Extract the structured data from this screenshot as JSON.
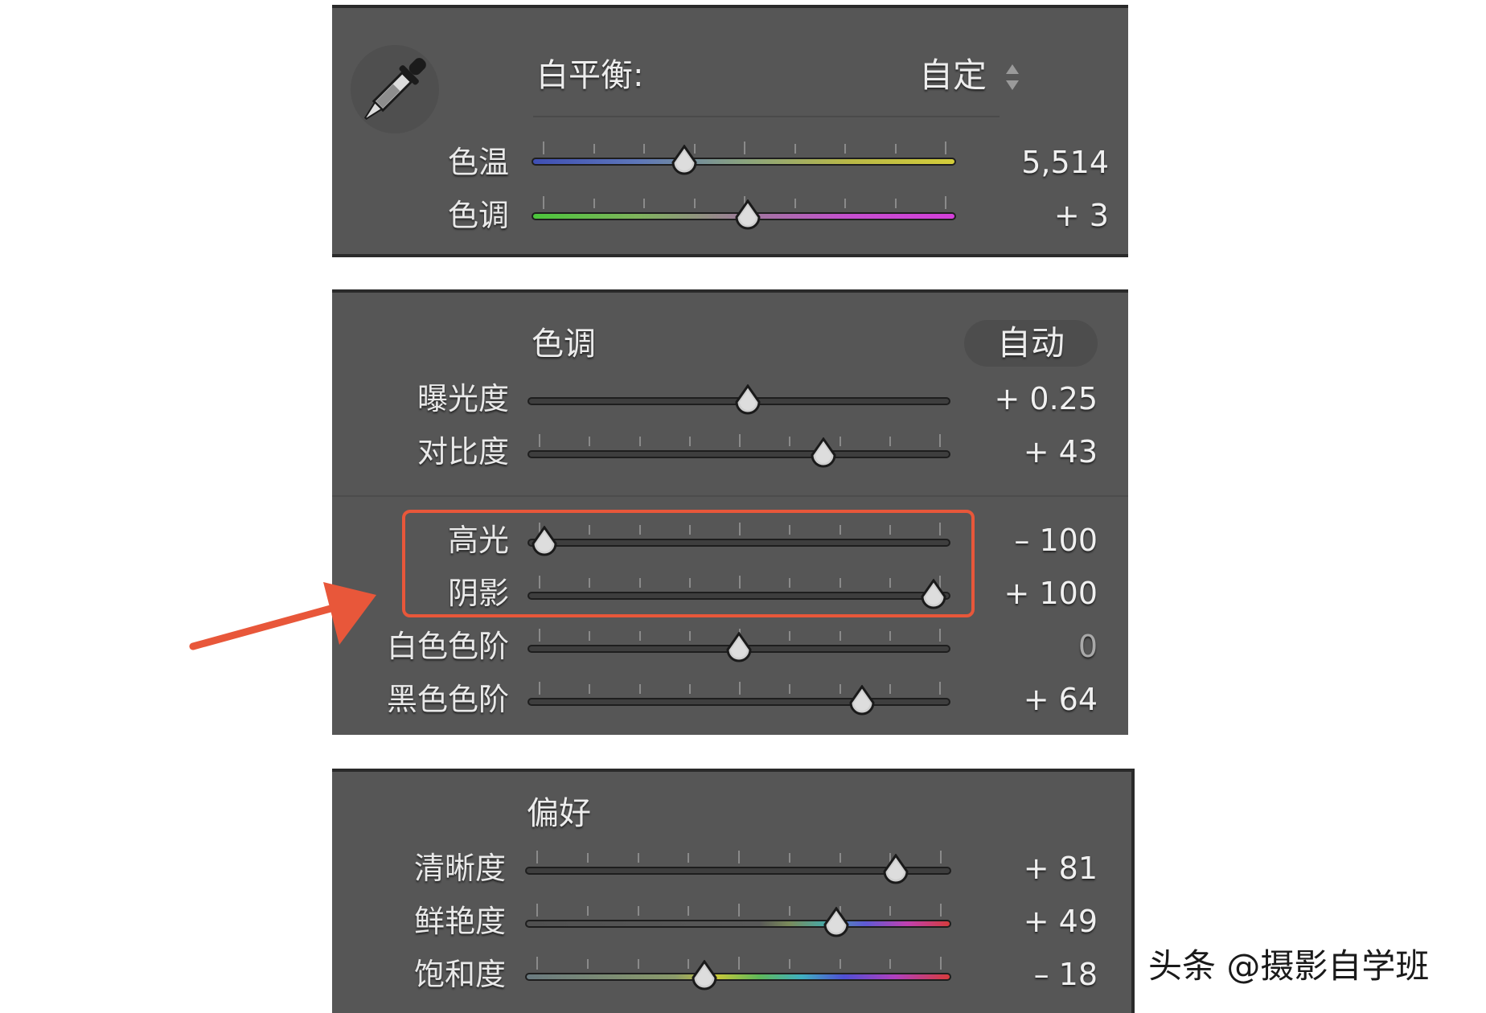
{
  "white_balance": {
    "label": "白平衡:",
    "mode": "自定",
    "sliders": [
      {
        "id": "temperature",
        "label": "色温",
        "value": "5,514",
        "position": 0.36
      },
      {
        "id": "tint",
        "label": "色调",
        "value": "+ 3",
        "position": 0.51
      }
    ]
  },
  "tone": {
    "title": "色调",
    "auto_label": "自动",
    "sliders": [
      {
        "id": "exposure",
        "label": "曝光度",
        "value": "+ 0.25",
        "position": 0.52
      },
      {
        "id": "contrast",
        "label": "对比度",
        "value": "+ 43",
        "position": 0.7
      },
      {
        "id": "highlights",
        "label": "高光",
        "value": "– 100",
        "position": 0.04
      },
      {
        "id": "shadows",
        "label": "阴影",
        "value": "+ 100",
        "position": 0.96
      },
      {
        "id": "whites",
        "label": "白色色阶",
        "value": "0",
        "position": 0.5
      },
      {
        "id": "blacks",
        "label": "黑色色阶",
        "value": "+ 64",
        "position": 0.79
      }
    ]
  },
  "presence": {
    "title": "偏好",
    "sliders": [
      {
        "id": "clarity",
        "label": "清晰度",
        "value": "+ 81",
        "position": 0.87
      },
      {
        "id": "vibrance",
        "label": "鲜艳度",
        "value": "+ 49",
        "position": 0.73
      },
      {
        "id": "saturation",
        "label": "饱和度",
        "value": "– 18",
        "position": 0.42
      }
    ]
  },
  "icons": [
    "eyedropper-icon",
    "updown-arrows-icon",
    "slider-thumb-icon",
    "annotation-arrow-icon"
  ],
  "colors": {
    "panel": "#565656",
    "highlight": "#e8573a",
    "text": "#e9e9e9"
  },
  "watermark": "头条 @摄影自学班"
}
